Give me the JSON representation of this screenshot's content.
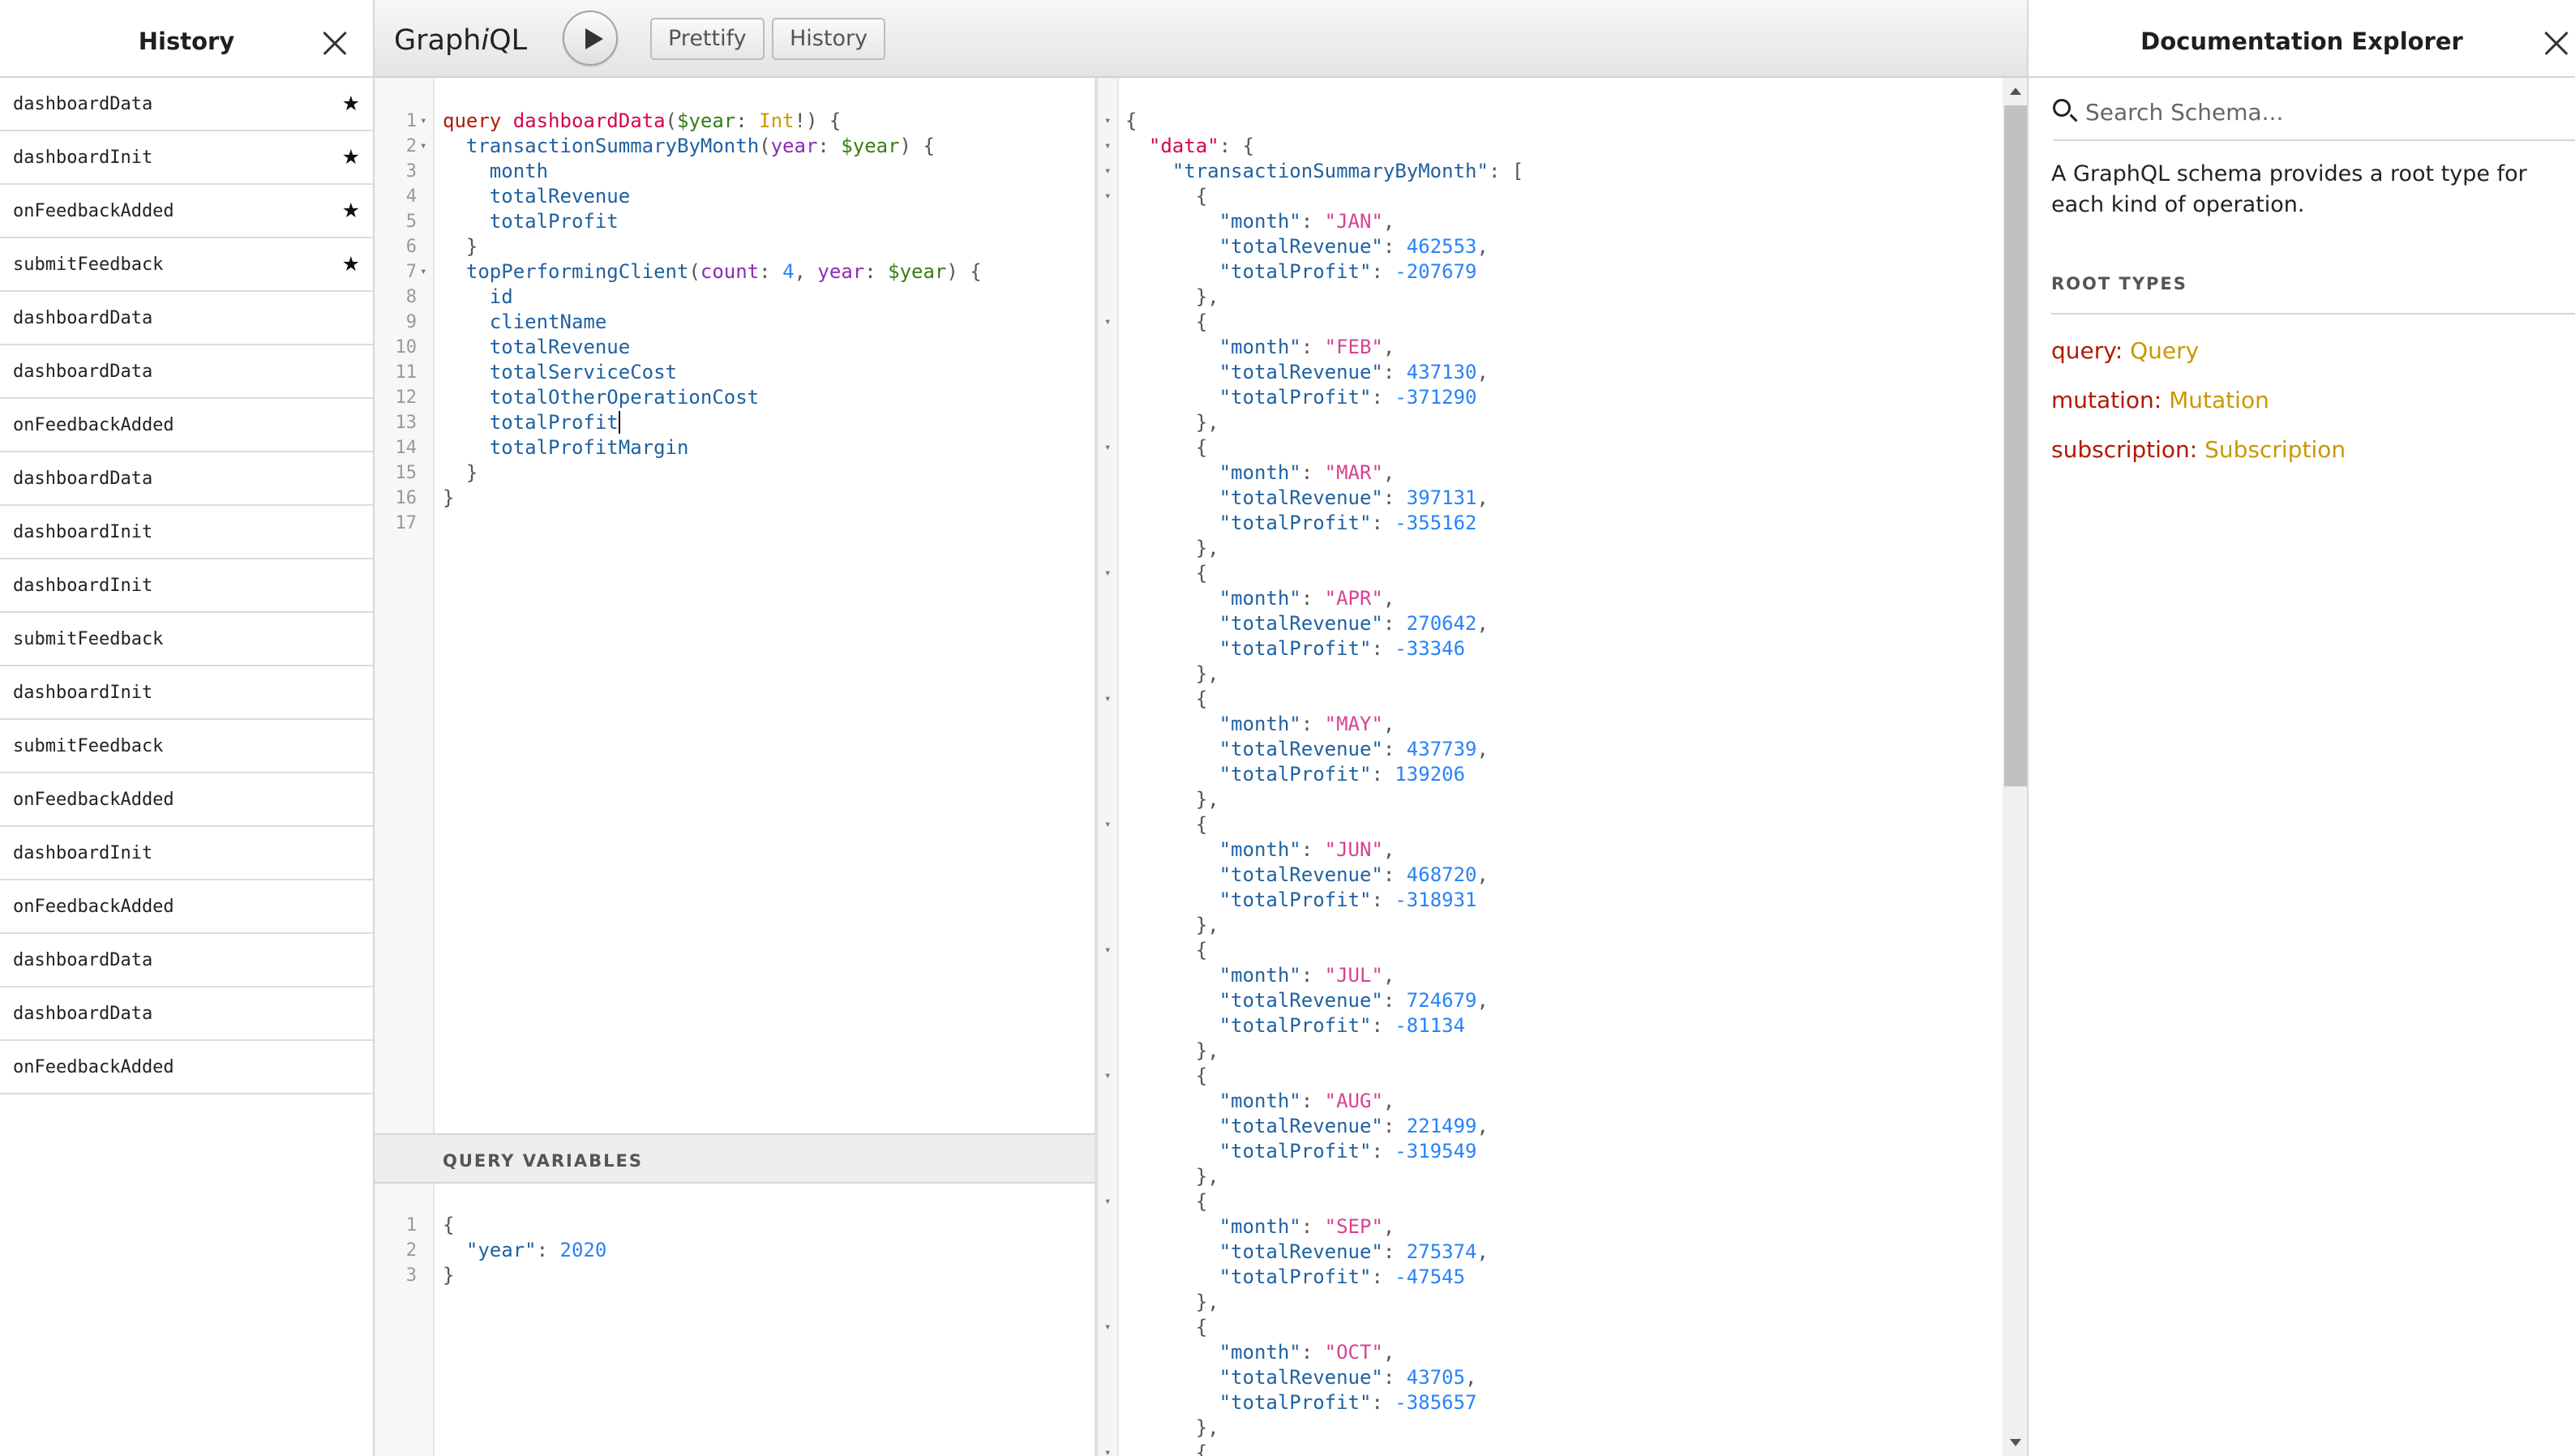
{
  "history": {
    "title": "History",
    "items": [
      {
        "label": "dashboardData",
        "starred": true
      },
      {
        "label": "dashboardInit",
        "starred": true
      },
      {
        "label": "onFeedbackAdded",
        "starred": true
      },
      {
        "label": "submitFeedback",
        "starred": true
      },
      {
        "label": "dashboardData",
        "starred": false
      },
      {
        "label": "dashboardData",
        "starred": false
      },
      {
        "label": "onFeedbackAdded",
        "starred": false
      },
      {
        "label": "dashboardData",
        "starred": false
      },
      {
        "label": "dashboardInit",
        "starred": false
      },
      {
        "label": "dashboardInit",
        "starred": false
      },
      {
        "label": "submitFeedback",
        "starred": false
      },
      {
        "label": "dashboardInit",
        "starred": false
      },
      {
        "label": "submitFeedback",
        "starred": false
      },
      {
        "label": "onFeedbackAdded",
        "starred": false
      },
      {
        "label": "dashboardInit",
        "starred": false
      },
      {
        "label": "onFeedbackAdded",
        "starred": false
      },
      {
        "label": "dashboardData",
        "starred": false
      },
      {
        "label": "dashboardData",
        "starred": false
      },
      {
        "label": "onFeedbackAdded",
        "starred": false
      }
    ]
  },
  "toolbar": {
    "logo_prefix": "Graph",
    "logo_i": "i",
    "logo_suffix": "QL",
    "prettify_label": "Prettify",
    "history_label": "History"
  },
  "query_editor": {
    "lines": [
      {
        "n": "1",
        "fold": true,
        "parts": [
          [
            "kw",
            "query"
          ],
          [
            "pun",
            " "
          ],
          [
            "def",
            "dashboardData"
          ],
          [
            "pun",
            "("
          ],
          [
            "var",
            "$year"
          ],
          [
            "pun",
            ": "
          ],
          [
            "type",
            "Int"
          ],
          [
            "pun",
            "!) {"
          ]
        ]
      },
      {
        "n": "2",
        "fold": true,
        "parts": [
          [
            "pun",
            "  "
          ],
          [
            "prop",
            "transactionSummaryByMonth"
          ],
          [
            "pun",
            "("
          ],
          [
            "attr",
            "year"
          ],
          [
            "pun",
            ": "
          ],
          [
            "var",
            "$year"
          ],
          [
            "pun",
            ") {"
          ]
        ]
      },
      {
        "n": "3",
        "fold": false,
        "parts": [
          [
            "pun",
            "    "
          ],
          [
            "prop",
            "month"
          ]
        ]
      },
      {
        "n": "4",
        "fold": false,
        "parts": [
          [
            "pun",
            "    "
          ],
          [
            "prop",
            "totalRevenue"
          ]
        ]
      },
      {
        "n": "5",
        "fold": false,
        "parts": [
          [
            "pun",
            "    "
          ],
          [
            "prop",
            "totalProfit"
          ]
        ]
      },
      {
        "n": "6",
        "fold": false,
        "parts": [
          [
            "pun",
            "  }"
          ]
        ]
      },
      {
        "n": "7",
        "fold": true,
        "parts": [
          [
            "pun",
            "  "
          ],
          [
            "prop",
            "topPerformingClient"
          ],
          [
            "pun",
            "("
          ],
          [
            "attr",
            "count"
          ],
          [
            "pun",
            ": "
          ],
          [
            "num",
            "4"
          ],
          [
            "pun",
            ", "
          ],
          [
            "attr",
            "year"
          ],
          [
            "pun",
            ": "
          ],
          [
            "var",
            "$year"
          ],
          [
            "pun",
            ") {"
          ]
        ]
      },
      {
        "n": "8",
        "fold": false,
        "parts": [
          [
            "pun",
            "    "
          ],
          [
            "prop",
            "id"
          ]
        ]
      },
      {
        "n": "9",
        "fold": false,
        "parts": [
          [
            "pun",
            "    "
          ],
          [
            "prop",
            "clientName"
          ]
        ]
      },
      {
        "n": "10",
        "fold": false,
        "parts": [
          [
            "pun",
            "    "
          ],
          [
            "prop",
            "totalRevenue"
          ]
        ]
      },
      {
        "n": "11",
        "fold": false,
        "parts": [
          [
            "pun",
            "    "
          ],
          [
            "prop",
            "totalServiceCost"
          ]
        ]
      },
      {
        "n": "12",
        "fold": false,
        "parts": [
          [
            "pun",
            "    "
          ],
          [
            "prop",
            "totalOtherOperationCost"
          ]
        ]
      },
      {
        "n": "13",
        "fold": false,
        "cursor": true,
        "parts": [
          [
            "pun",
            "    "
          ],
          [
            "prop",
            "totalProfit"
          ]
        ]
      },
      {
        "n": "14",
        "fold": false,
        "parts": [
          [
            "pun",
            "    "
          ],
          [
            "prop",
            "totalProfitMargin"
          ]
        ]
      },
      {
        "n": "15",
        "fold": false,
        "parts": [
          [
            "pun",
            "  }"
          ]
        ]
      },
      {
        "n": "16",
        "fold": false,
        "parts": [
          [
            "pun",
            "}"
          ]
        ]
      },
      {
        "n": "17",
        "fold": false,
        "parts": []
      }
    ]
  },
  "variables": {
    "header": "QUERY VARIABLES",
    "lines": [
      {
        "n": "1",
        "parts": [
          [
            "pun",
            "{"
          ]
        ]
      },
      {
        "n": "2",
        "parts": [
          [
            "pun",
            "  "
          ],
          [
            "prop",
            "\"year\""
          ],
          [
            "pun",
            ": "
          ],
          [
            "num",
            "2020"
          ]
        ]
      },
      {
        "n": "3",
        "parts": [
          [
            "pun",
            "}"
          ]
        ]
      }
    ]
  },
  "result": {
    "open_lines": [
      {
        "fold": true,
        "parts": [
          [
            "pun",
            "{"
          ]
        ]
      },
      {
        "fold": true,
        "parts": [
          [
            "pun",
            "  "
          ],
          [
            "def",
            "\"data\""
          ],
          [
            "pun",
            ": {"
          ]
        ]
      },
      {
        "fold": true,
        "parts": [
          [
            "pun",
            "    "
          ],
          [
            "prop",
            "\"transactionSummaryByMonth\""
          ],
          [
            "pun",
            ": ["
          ]
        ]
      }
    ],
    "months": [
      {
        "month": "\"JAN\"",
        "revenue": "462553",
        "profit": "-207679"
      },
      {
        "month": "\"FEB\"",
        "revenue": "437130",
        "profit": "-371290"
      },
      {
        "month": "\"MAR\"",
        "revenue": "397131",
        "profit": "-355162"
      },
      {
        "month": "\"APR\"",
        "revenue": "270642",
        "profit": "-33346"
      },
      {
        "month": "\"MAY\"",
        "revenue": "437739",
        "profit": "139206"
      },
      {
        "month": "\"JUN\"",
        "revenue": "468720",
        "profit": "-318931"
      },
      {
        "month": "\"JUL\"",
        "revenue": "724679",
        "profit": "-81134"
      },
      {
        "month": "\"AUG\"",
        "revenue": "221499",
        "profit": "-319549"
      },
      {
        "month": "\"SEP\"",
        "revenue": "275374",
        "profit": "-47545"
      },
      {
        "month": "\"OCT\"",
        "revenue": "43705",
        "profit": "-385657"
      }
    ],
    "keys": {
      "month": "\"month\"",
      "revenue": "\"totalRevenue\"",
      "profit": "\"totalProfit\""
    }
  },
  "docs": {
    "title": "Documentation Explorer",
    "search_placeholder": "Search Schema...",
    "description": "A GraphQL schema provides a root type for each kind of operation.",
    "section_title": "ROOT TYPES",
    "root_types": [
      {
        "field": "query",
        "type": "Query"
      },
      {
        "field": "mutation",
        "type": "Mutation"
      },
      {
        "field": "subscription",
        "type": "Subscription"
      }
    ]
  },
  "colors": {
    "keyword": "#b11a04",
    "definition": "#d2054e",
    "variable": "#397d13",
    "type": "#ca9800",
    "property": "#1f61a0",
    "argument": "#8b2bb9",
    "number": "#2882f9",
    "string": "#d64292"
  }
}
